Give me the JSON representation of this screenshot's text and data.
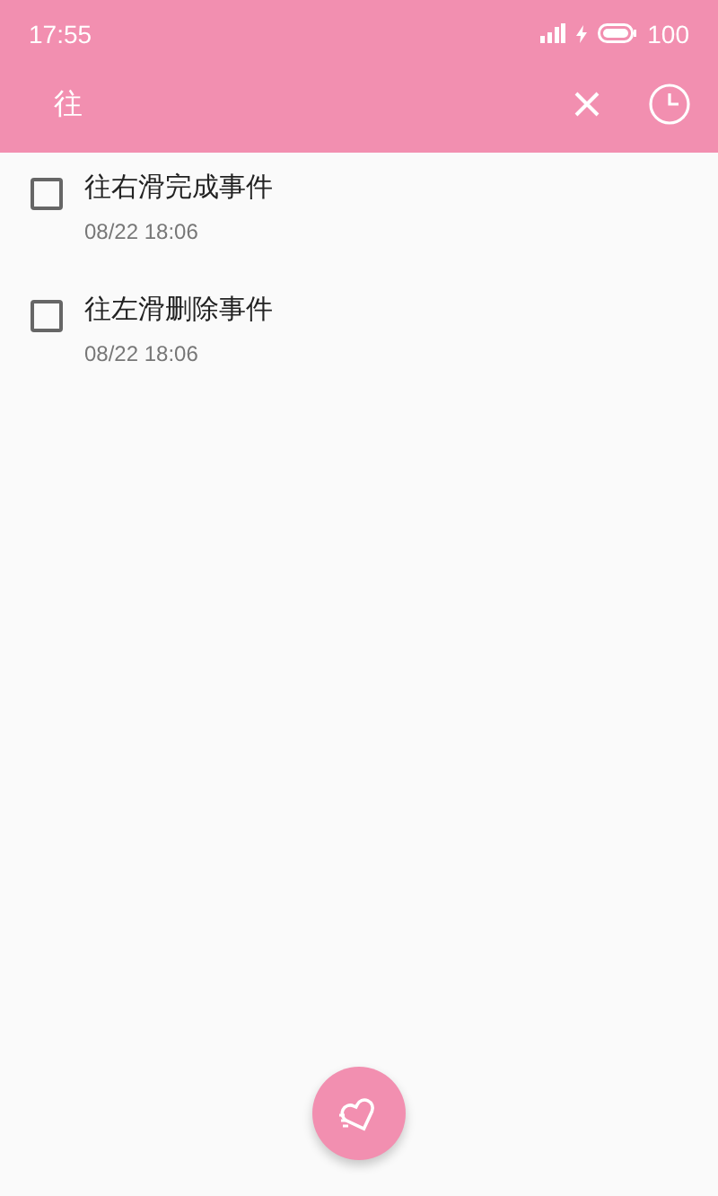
{
  "status_bar": {
    "time": "17:55",
    "battery": "100"
  },
  "search": {
    "value": "往"
  },
  "tasks": [
    {
      "title": "往右滑完成事件",
      "time": "08/22 18:06",
      "checked": false
    },
    {
      "title": "往左滑删除事件",
      "time": "08/22 18:06",
      "checked": false
    }
  ]
}
